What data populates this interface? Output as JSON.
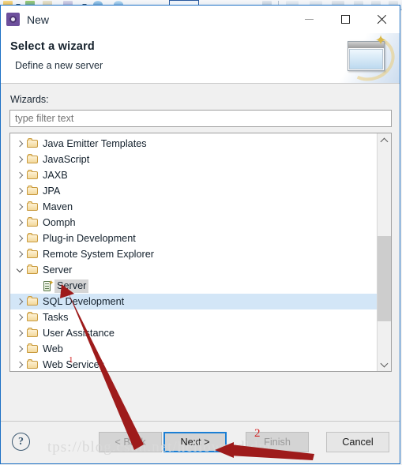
{
  "background": {
    "toolbar_name": "eclipse-toolbar-strip"
  },
  "dialog": {
    "title": "New",
    "title_icon": "wizard-gear-icon",
    "window_controls": [
      {
        "name": "minimize",
        "glyph": "—"
      },
      {
        "name": "maximize",
        "glyph": "□"
      },
      {
        "name": "close",
        "glyph": "✕"
      }
    ],
    "header": {
      "title": "Select a wizard",
      "subtitle": "Define a new server",
      "banner_icon": "wizard-sparkle-window-icon"
    },
    "body": {
      "wizards_label": "Wizards:",
      "filter": {
        "value": "",
        "placeholder": "type filter text"
      },
      "tree": [
        {
          "label": "Java Emitter Templates",
          "icon": "folder-icon",
          "expanded": false,
          "indent": 0,
          "state": "normal"
        },
        {
          "label": "JavaScript",
          "icon": "folder-icon",
          "expanded": false,
          "indent": 0,
          "state": "normal"
        },
        {
          "label": "JAXB",
          "icon": "folder-icon",
          "expanded": false,
          "indent": 0,
          "state": "normal"
        },
        {
          "label": "JPA",
          "icon": "folder-icon",
          "expanded": false,
          "indent": 0,
          "state": "normal"
        },
        {
          "label": "Maven",
          "icon": "folder-icon",
          "expanded": false,
          "indent": 0,
          "state": "normal"
        },
        {
          "label": "Oomph",
          "icon": "folder-icon",
          "expanded": false,
          "indent": 0,
          "state": "normal"
        },
        {
          "label": "Plug-in Development",
          "icon": "folder-icon",
          "expanded": false,
          "indent": 0,
          "state": "normal"
        },
        {
          "label": "Remote System Explorer",
          "icon": "folder-icon",
          "expanded": false,
          "indent": 0,
          "state": "normal"
        },
        {
          "label": "Server",
          "icon": "folder-icon",
          "expanded": true,
          "indent": 0,
          "state": "normal"
        },
        {
          "label": "Server",
          "icon": "server-icon",
          "expanded": null,
          "indent": 1,
          "state": "selected-gray"
        },
        {
          "label": "SQL Development",
          "icon": "folder-icon",
          "expanded": false,
          "indent": 0,
          "state": "highlight-blue"
        },
        {
          "label": "Tasks",
          "icon": "folder-icon",
          "expanded": false,
          "indent": 0,
          "state": "normal"
        },
        {
          "label": "User Assistance",
          "icon": "folder-icon",
          "expanded": false,
          "indent": 0,
          "state": "normal"
        },
        {
          "label": "Web",
          "icon": "folder-icon",
          "expanded": false,
          "indent": 0,
          "state": "normal"
        },
        {
          "label": "Web Services",
          "icon": "folder-icon",
          "expanded": false,
          "indent": 0,
          "state": "normal"
        }
      ],
      "scrollbar": {
        "up_arrow": "▲",
        "down_arrow": "▼"
      }
    },
    "footer": {
      "help_label": "?",
      "buttons": [
        {
          "label": "< Back",
          "name": "back-button",
          "enabled": false
        },
        {
          "label": "Next >",
          "name": "next-button",
          "enabled": true,
          "focused": true
        },
        {
          "label": "Finish",
          "name": "finish-button",
          "enabled": false
        },
        {
          "label": "Cancel",
          "name": "cancel-button",
          "enabled": true
        }
      ]
    }
  },
  "annotations": {
    "watermark": "tps://blog.csdn.net/hellowordldm",
    "marker_two": "2",
    "marker_one": "1",
    "arrow_to_server": "red-arrow-pointing-to-server-item",
    "arrow_to_next": "red-arrow-pointing-to-next-button"
  },
  "colors": {
    "dialog_border": "#1b6fc4",
    "focus_blue": "#1b7fd4",
    "selection_blue": "#d3e6f7",
    "selection_gray": "#d5d5d5",
    "annotation_red": "#d32020",
    "folder_gold": "#f3d89b"
  }
}
